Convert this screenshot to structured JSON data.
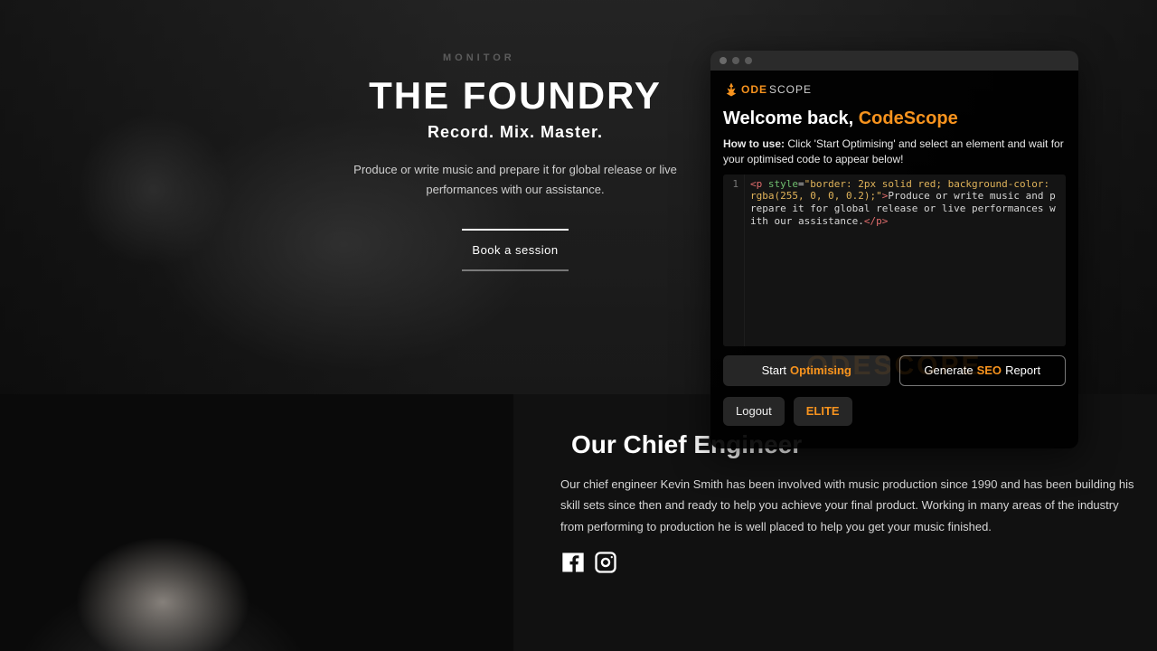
{
  "hero": {
    "bg_label": "MONITOR",
    "title": "THE FOUNDRY",
    "subtitle": "Record. Mix. Master.",
    "description": "Produce or write music and prepare it for global release or live performances with our assistance.",
    "cta": "Book a session"
  },
  "engineer": {
    "heading": "Our Chief Engineer",
    "body": "Our chief engineer Kevin Smith has been involved with music production since 1990 and has been building his skill sets since then and ready to help you achieve your final product. Working in many areas of the industry from performing to production he is well placed to help you get your music finished."
  },
  "panel": {
    "logo": {
      "word1": "ODE",
      "word2": "SCOPE"
    },
    "welcome_prefix": "Welcome back, ",
    "welcome_name": "CodeScope",
    "howto_label": "How to use:",
    "howto_text": " Click 'Start Optimising' and select an element and wait for your optimised code to appear below!",
    "code": {
      "line_no": "1",
      "open_tag": "<p",
      "attr_name": "style",
      "eq": "=",
      "attr_q": "\"",
      "style_value": "border: 2px solid red; background-color: rgba(255, 0, 0, 0.2);",
      "open_close": ">",
      "inner": "Produce or write music and prepare it for global release or live performances with our assistance.",
      "close_tag": "</p>"
    },
    "watermark": "ODESCOPE",
    "start_prefix": "Start",
    "start_accent": "Optimising",
    "gen_prefix": "Generate",
    "gen_accent": "SEO",
    "gen_suffix": "Report",
    "logout": "Logout",
    "elite": "ELITE"
  }
}
